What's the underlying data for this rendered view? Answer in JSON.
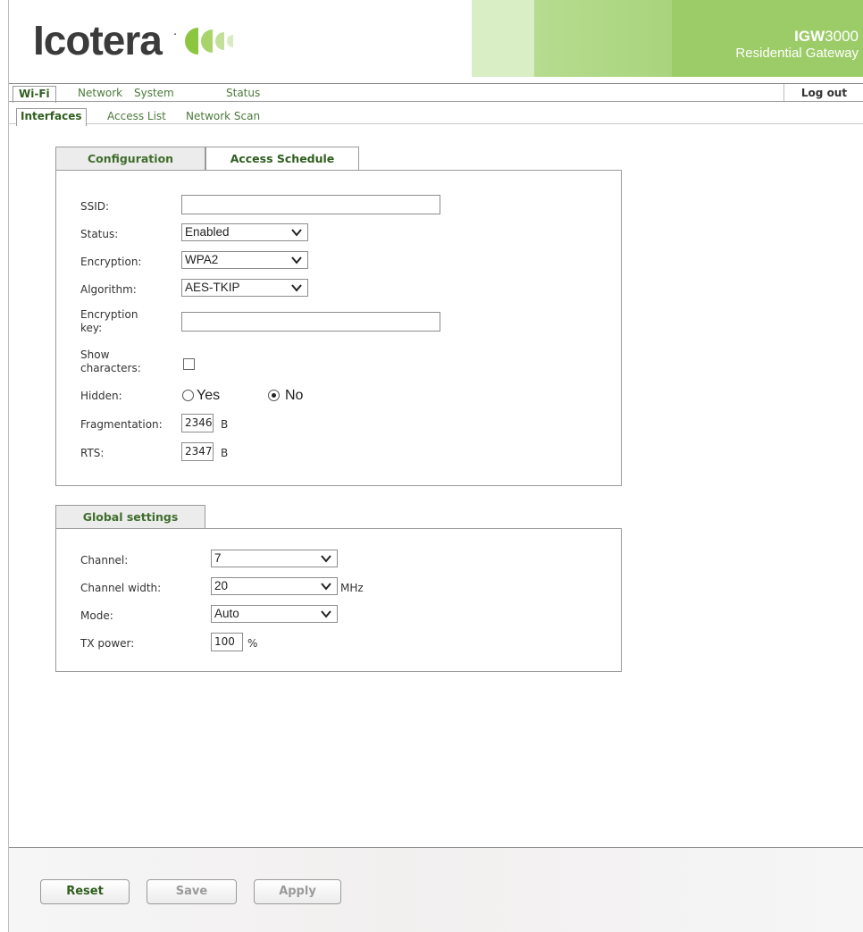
{
  "header": {
    "brand": "Icotera",
    "trademark": "·",
    "product_bold": "IGW",
    "product_model": "3000",
    "product_subtitle": "Residential Gateway"
  },
  "nav": {
    "tabs": [
      {
        "label": "Wi-Fi",
        "active": true
      },
      {
        "label": "Network",
        "active": false
      },
      {
        "label": "System",
        "active": false
      },
      {
        "label": "Status",
        "active": false
      }
    ],
    "logout": "Log out"
  },
  "subnav": {
    "tabs": [
      {
        "label": "Interfaces",
        "active": true
      },
      {
        "label": "Access List",
        "active": false
      },
      {
        "label": "Network Scan",
        "active": false
      }
    ]
  },
  "config_panel": {
    "tabs": [
      {
        "label": "Configuration",
        "active": true
      },
      {
        "label": "Access Schedule",
        "active": false
      }
    ],
    "ssid": {
      "label": "SSID:",
      "value": ""
    },
    "status": {
      "label": "Status:",
      "value": "Enabled"
    },
    "encryption": {
      "label": "Encryption:",
      "value": "WPA2"
    },
    "algorithm": {
      "label": "Algorithm:",
      "value": "AES-TKIP"
    },
    "encryption_key": {
      "label_line1": "Encryption",
      "label_line2": "key:",
      "value": ""
    },
    "show_characters": {
      "label_line1": "Show",
      "label_line2": "characters:",
      "checked": false
    },
    "hidden": {
      "label": "Hidden:",
      "yes": "Yes",
      "no": "No",
      "selected": "No"
    },
    "fragmentation": {
      "label": "Fragmentation:",
      "value": "2346",
      "unit": "B"
    },
    "rts": {
      "label": "RTS:",
      "value": "2347",
      "unit": "B"
    }
  },
  "global_panel": {
    "tab": "Global settings",
    "channel": {
      "label": "Channel:",
      "value": "7"
    },
    "channel_width": {
      "label": "Channel width:",
      "value": "20",
      "unit": "MHz"
    },
    "mode": {
      "label": "Mode:",
      "value": "Auto"
    },
    "tx_power": {
      "label": "TX power:",
      "value": "100",
      "unit": "%"
    }
  },
  "footer": {
    "reset": "Reset",
    "save": "Save",
    "apply": "Apply"
  },
  "colors": {
    "accent_green": "#9ccc68",
    "label_green": "#3f6e2c"
  }
}
